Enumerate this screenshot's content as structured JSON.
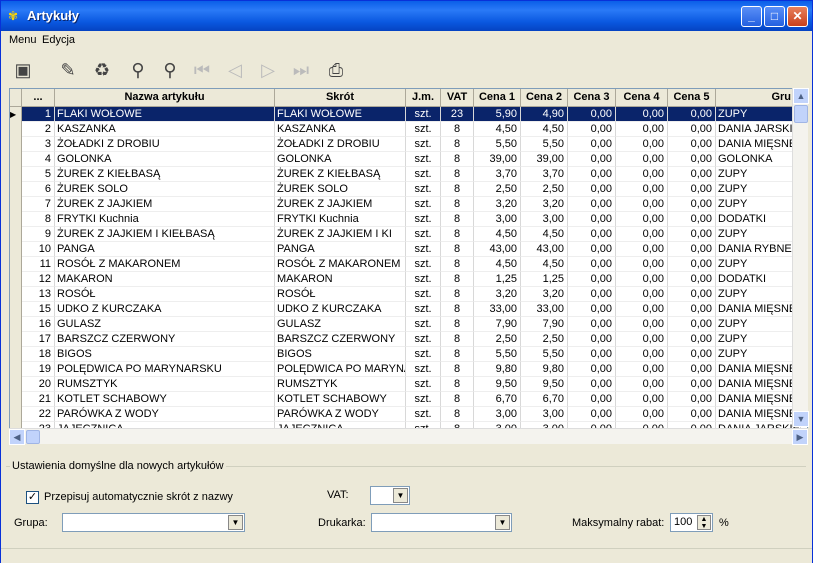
{
  "window": {
    "title": "Artykuły"
  },
  "menu": {
    "items": [
      "Menu",
      "Edycja"
    ]
  },
  "toolbar": {
    "icons": [
      "add-icon",
      "edit-icon",
      "delete-icon",
      "search-icon",
      "search-next-icon",
      "first-icon",
      "prev-icon",
      "next-icon",
      "last-icon",
      "print-icon"
    ]
  },
  "grid": {
    "columns": [
      "...",
      "Nazwa artykułu",
      "Skrót",
      "J.m.",
      "VAT",
      "Cena 1",
      "Cena 2",
      "Cena 3",
      "Cena 4",
      "Cena 5",
      "Gru"
    ],
    "rows": [
      [
        "1",
        "FLAKI WOŁOWE",
        "FLAKI WOŁOWE",
        "szt.",
        "23",
        "5,90",
        "4,90",
        "0,00",
        "0,00",
        "0,00",
        "ZUPY"
      ],
      [
        "2",
        "KASZANKA",
        "KASZANKA",
        "szt.",
        "8",
        "4,50",
        "4,50",
        "0,00",
        "0,00",
        "0,00",
        "DANIA JARSKIE"
      ],
      [
        "3",
        "ŻOŁADKI Z DROBIU",
        "ŻOŁADKI Z DROBIU",
        "szt.",
        "8",
        "5,50",
        "5,50",
        "0,00",
        "0,00",
        "0,00",
        "DANIA MIĘSNE"
      ],
      [
        "4",
        "GOLONKA",
        "GOLONKA",
        "szt.",
        "8",
        "39,00",
        "39,00",
        "0,00",
        "0,00",
        "0,00",
        "GOLONKA"
      ],
      [
        "5",
        "ŻUREK Z KIEŁBASĄ",
        "ŻUREK Z KIEŁBASĄ",
        "szt.",
        "8",
        "3,70",
        "3,70",
        "0,00",
        "0,00",
        "0,00",
        "ZUPY"
      ],
      [
        "6",
        "ŻUREK SOLO",
        "ŻUREK SOLO",
        "szt.",
        "8",
        "2,50",
        "2,50",
        "0,00",
        "0,00",
        "0,00",
        "ZUPY"
      ],
      [
        "7",
        "ŻUREK Z JAJKIEM",
        "ŻUREK Z JAJKIEM",
        "szt.",
        "8",
        "3,20",
        "3,20",
        "0,00",
        "0,00",
        "0,00",
        "ZUPY"
      ],
      [
        "8",
        "FRYTKI Kuchnia",
        "FRYTKI Kuchnia",
        "szt.",
        "8",
        "3,00",
        "3,00",
        "0,00",
        "0,00",
        "0,00",
        "DODATKI"
      ],
      [
        "9",
        "ŻUREK Z JAJKIEM I KIEŁBASĄ",
        "ŻUREK Z JAJKIEM I KI",
        "szt.",
        "8",
        "4,50",
        "4,50",
        "0,00",
        "0,00",
        "0,00",
        "ZUPY"
      ],
      [
        "10",
        "PANGA",
        "PANGA",
        "szt.",
        "8",
        "43,00",
        "43,00",
        "0,00",
        "0,00",
        "0,00",
        "DANIA RYBNE"
      ],
      [
        "11",
        "ROSÓŁ Z MAKARONEM",
        "ROSÓŁ Z MAKARONEM",
        "szt.",
        "8",
        "4,50",
        "4,50",
        "0,00",
        "0,00",
        "0,00",
        "ZUPY"
      ],
      [
        "12",
        "MAKARON",
        "MAKARON",
        "szt.",
        "8",
        "1,25",
        "1,25",
        "0,00",
        "0,00",
        "0,00",
        "DODATKI"
      ],
      [
        "13",
        "ROSÓŁ",
        "ROSÓŁ",
        "szt.",
        "8",
        "3,20",
        "3,20",
        "0,00",
        "0,00",
        "0,00",
        "ZUPY"
      ],
      [
        "15",
        "UDKO Z KURCZAKA",
        "UDKO Z KURCZAKA",
        "szt.",
        "8",
        "33,00",
        "33,00",
        "0,00",
        "0,00",
        "0,00",
        "DANIA MIĘSNE"
      ],
      [
        "16",
        "GULASZ",
        "GULASZ",
        "szt.",
        "8",
        "7,90",
        "7,90",
        "0,00",
        "0,00",
        "0,00",
        "ZUPY"
      ],
      [
        "17",
        "BARSZCZ CZERWONY",
        "BARSZCZ CZERWONY",
        "szt.",
        "8",
        "2,50",
        "2,50",
        "0,00",
        "0,00",
        "0,00",
        "ZUPY"
      ],
      [
        "18",
        "BIGOS",
        "BIGOS",
        "szt.",
        "8",
        "5,50",
        "5,50",
        "0,00",
        "0,00",
        "0,00",
        "ZUPY"
      ],
      [
        "19",
        "POLĘDWICA PO MARYNARSKU",
        "POLĘDWICA PO MARYNAI",
        "szt.",
        "8",
        "9,80",
        "9,80",
        "0,00",
        "0,00",
        "0,00",
        "DANIA MIĘSNE"
      ],
      [
        "20",
        "RUMSZTYK",
        "RUMSZTYK",
        "szt.",
        "8",
        "9,50",
        "9,50",
        "0,00",
        "0,00",
        "0,00",
        "DANIA MIĘSNE"
      ],
      [
        "21",
        "KOTLET SCHABOWY",
        "KOTLET SCHABOWY",
        "szt.",
        "8",
        "6,70",
        "6,70",
        "0,00",
        "0,00",
        "0,00",
        "DANIA MIĘSNE"
      ],
      [
        "22",
        "PARÓWKA Z WODY",
        "PARÓWKA Z WODY",
        "szt.",
        "8",
        "3,00",
        "3,00",
        "0,00",
        "0,00",
        "0,00",
        "DANIA MIĘSNE"
      ],
      [
        "23",
        "JAJECZNICA",
        "JAJECZNICA",
        "szt.",
        "8",
        "3,00",
        "3,00",
        "0,00",
        "0,00",
        "0,00",
        "DANIA JARSKIE"
      ]
    ]
  },
  "settings": {
    "group_label": "Ustawienia domyślne dla nowych artykułów",
    "auto_abbrev_label": "Przepisuj automatycznie skrót z nazwy",
    "auto_abbrev_checked": "✓",
    "vat_label": "VAT:",
    "group_field_label": "Grupa:",
    "printer_label": "Drukarka:",
    "max_discount_label": "Maksymalny rabat:",
    "max_discount_value": "100",
    "percent_sign": "%"
  }
}
